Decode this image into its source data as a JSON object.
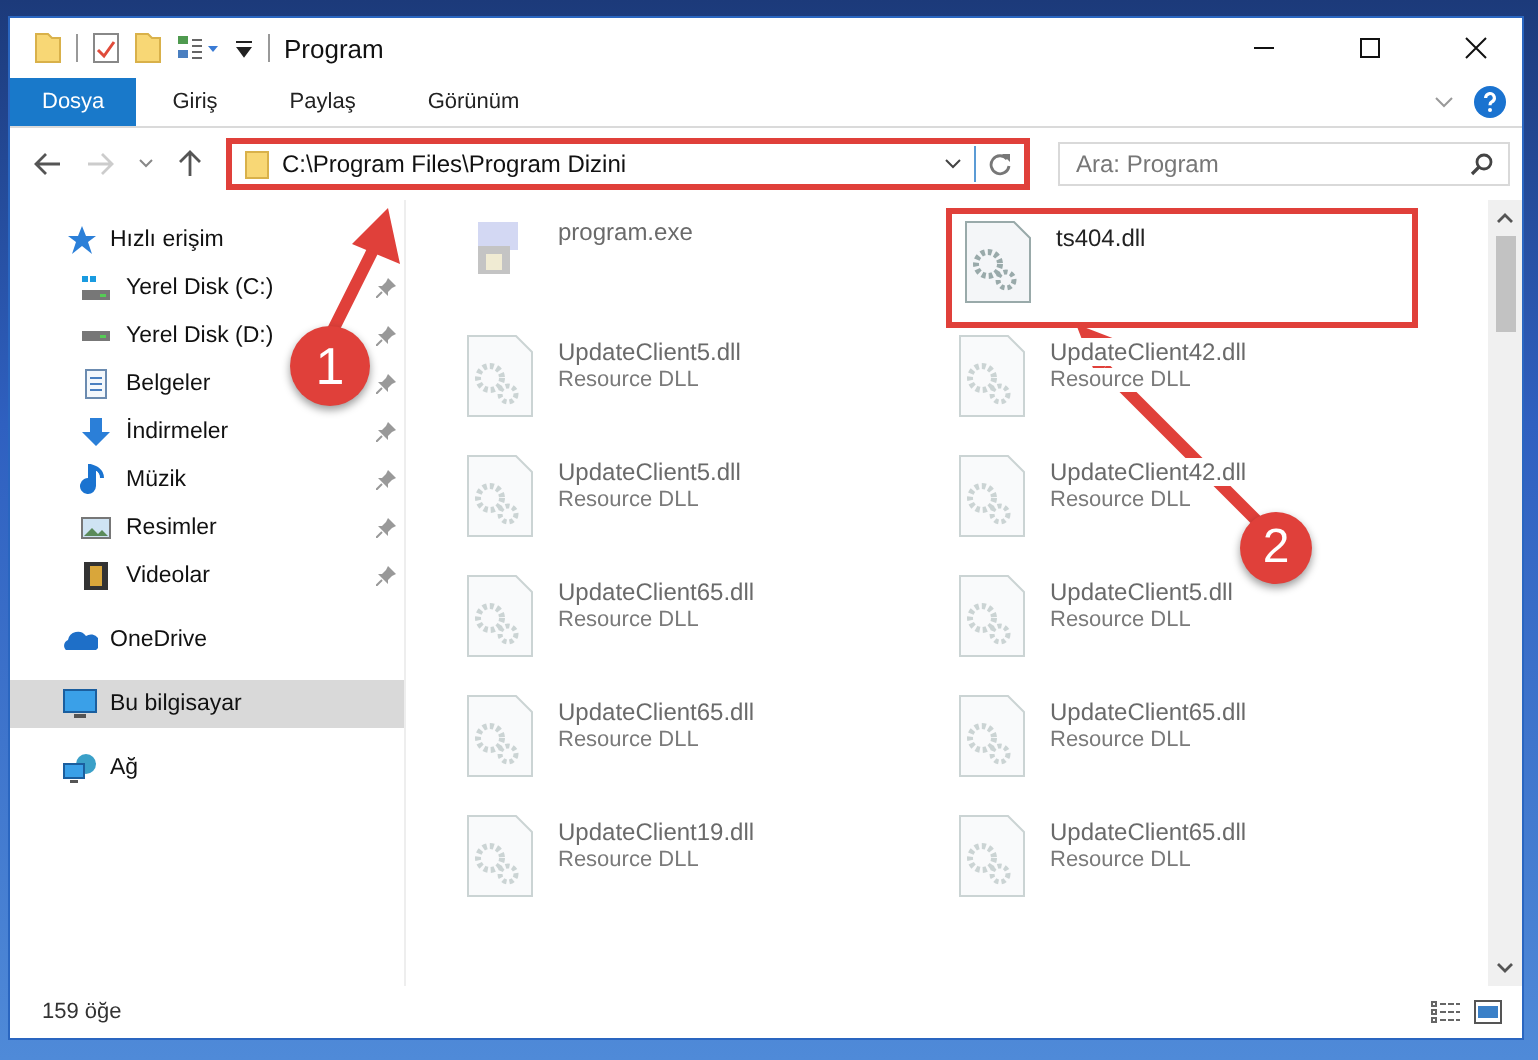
{
  "window": {
    "title": "Program"
  },
  "ribbon_tabs": [
    {
      "label": "Dosya",
      "selected": true
    },
    {
      "label": "Giriş",
      "selected": false
    },
    {
      "label": "Paylaş",
      "selected": false
    },
    {
      "label": "Görünüm",
      "selected": false
    }
  ],
  "address_bar": {
    "path": "C:\\Program Files\\Program Dizini",
    "highlighted": true
  },
  "search": {
    "placeholder": "Ara: Program"
  },
  "sidebar": {
    "items": [
      {
        "label": "Hızlı erişim",
        "kind": "star",
        "selected": false,
        "children": [
          {
            "label": "Yerel Disk (C:)",
            "kind": "drive-c",
            "pinned": true,
            "selected": false
          },
          {
            "label": "Yerel Disk (D:)",
            "kind": "drive",
            "pinned": true,
            "selected": false
          },
          {
            "label": "Belgeler",
            "kind": "document",
            "pinned": true,
            "selected": false
          },
          {
            "label": "İndirmeler",
            "kind": "download",
            "pinned": true,
            "selected": false
          },
          {
            "label": "Müzik",
            "kind": "music",
            "pinned": true,
            "selected": false
          },
          {
            "label": "Resimler",
            "kind": "picture",
            "pinned": true,
            "selected": false
          },
          {
            "label": "Videolar",
            "kind": "video",
            "pinned": true,
            "selected": false
          }
        ]
      },
      {
        "label": "OneDrive",
        "kind": "cloud",
        "selected": false
      },
      {
        "label": "Bu bilgisayar",
        "kind": "computer",
        "selected": true
      },
      {
        "label": "Ağ",
        "kind": "network",
        "selected": false
      }
    ]
  },
  "files": [
    {
      "name": "program.exe",
      "kind": "exe",
      "blurred": true,
      "highlighted": false
    },
    {
      "name": "ts404.dll",
      "kind": "dll",
      "blurred": false,
      "highlighted": true
    },
    {
      "name": "UpdateClient5.dll",
      "type": "Resource DLL",
      "kind": "dll",
      "blurred": true,
      "highlighted": false
    },
    {
      "name": "UpdateClient42.dll",
      "type": "Resource DLL",
      "kind": "dll",
      "blurred": true,
      "highlighted": false
    },
    {
      "name": "UpdateClient5.dll",
      "type": "Resource DLL",
      "kind": "dll",
      "blurred": true,
      "highlighted": false
    },
    {
      "name": "UpdateClient42.dll",
      "type": "Resource DLL",
      "kind": "dll",
      "blurred": true,
      "highlighted": false
    },
    {
      "name": "UpdateClient65.dll",
      "type": "Resource DLL",
      "kind": "dll",
      "blurred": true,
      "highlighted": false
    },
    {
      "name": "UpdateClient5.dll",
      "type": "Resource DLL",
      "kind": "dll",
      "blurred": true,
      "highlighted": false
    },
    {
      "name": "UpdateClient65.dll",
      "type": "Resource DLL",
      "kind": "dll",
      "blurred": true,
      "highlighted": false
    },
    {
      "name": "UpdateClient65.dll",
      "type": "Resource DLL",
      "kind": "dll",
      "blurred": true,
      "highlighted": false
    },
    {
      "name": "UpdateClient19.dll",
      "type": "Resource DLL",
      "kind": "dll",
      "blurred": true,
      "highlighted": false
    },
    {
      "name": "UpdateClient65.dll",
      "type": "Resource DLL",
      "kind": "dll",
      "blurred": true,
      "highlighted": false
    }
  ],
  "annotations": [
    {
      "number": "1"
    },
    {
      "number": "2"
    }
  ],
  "status_bar": {
    "count": "159 öğe"
  }
}
